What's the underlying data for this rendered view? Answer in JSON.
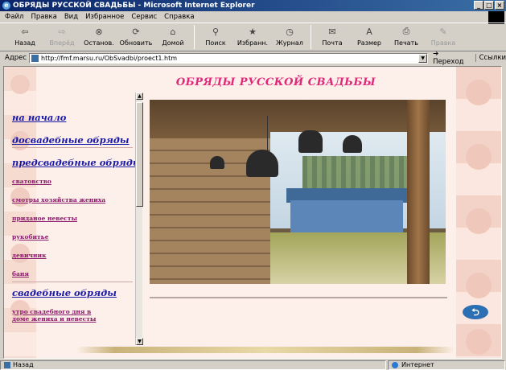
{
  "window": {
    "title": "ОБРЯДЫ РУССКОЙ СВАДЬБЫ - Microsoft Internet Explorer",
    "controls": [
      "_",
      "□",
      "×"
    ]
  },
  "menu": [
    "Файл",
    "Правка",
    "Вид",
    "Избранное",
    "Сервис",
    "Справка"
  ],
  "toolbar": {
    "back": "Назад",
    "forward": "Вперёд",
    "stop": "Останов.",
    "refresh": "Обновить",
    "home": "Домой",
    "search": "Поиск",
    "favorites": "Избранн.",
    "history": "Журнал",
    "mail": "Почта",
    "size": "Размер",
    "print": "Печать",
    "edit": "Правка"
  },
  "address": {
    "label": "Адрес",
    "url": "http://fmf.marsu.ru/ObSvadbi/proect1.htm",
    "go": "Переход",
    "links": "Ссылки"
  },
  "page": {
    "title": "ОБРЯДЫ РУССКОЙ СВАДЬБЫ",
    "nav": {
      "home": "на начало",
      "pre_wedding": "досвадебные обряды",
      "before_wedding": "предсвадебные обряды",
      "matchmaking": "сватовство",
      "groom_household": "смотры хозяйства жениха",
      "dowry": "приданое невесты",
      "handshake": "рукобитье",
      "bachelorette": "девичник",
      "bath": "баня",
      "wedding_rites": "свадебные обряды",
      "morning": "утро свадебного дня в доме жениха и невесты"
    }
  },
  "status": {
    "text": "Назад",
    "zone": "Интернет"
  },
  "colors": {
    "title": "#e0287a",
    "nav_main": "#1a1aa6",
    "nav_sub": "#8a1a6a",
    "page_bg": "#fdf0ea"
  }
}
